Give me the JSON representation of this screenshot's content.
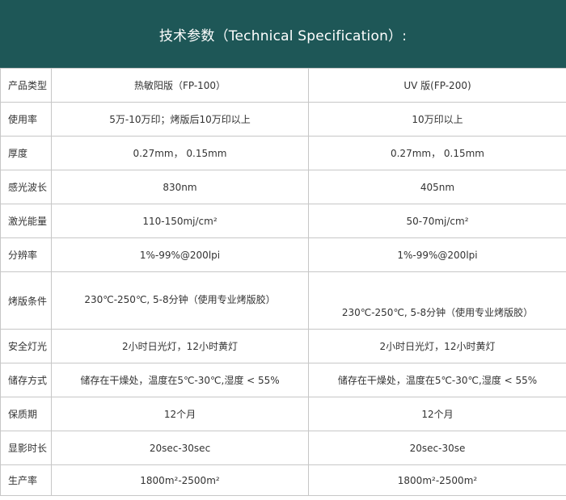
{
  "header": {
    "title": "技术参数（Technical Specification）:"
  },
  "table": {
    "rows": [
      {
        "label": "产品类型",
        "thermal": "热敏阳版（FP-100）",
        "uv": "UV 版(FP-200)"
      },
      {
        "label": "使用率",
        "thermal": "5万-10万印；烤版后10万印以上",
        "uv": "10万印以上"
      },
      {
        "label": "厚度",
        "thermal": "0.27mm， 0.15mm",
        "uv": "0.27mm， 0.15mm"
      },
      {
        "label": "感光波长",
        "thermal": "830nm",
        "uv": "405nm"
      },
      {
        "label": "激光能量",
        "thermal": "110-150mj/cm²",
        "uv": "50-70mj/cm²"
      },
      {
        "label": "分辨率",
        "thermal": "1%-99%@200lpi",
        "uv": "1%-99%@200lpi"
      },
      {
        "label": "烤版条件",
        "thermal": "230℃-250℃, 5-8分钟（使用专业烤版胶）",
        "uv": "230℃-250℃, 5-8分钟（使用专业烤版胶）"
      },
      {
        "label": "安全灯光",
        "thermal": "2小时日光灯，12小时黄灯",
        "uv": "2小时日光灯，12小时黄灯"
      },
      {
        "label": "储存方式",
        "thermal": "储存在干燥处，温度在5℃-30℃,湿度 < 55%",
        "uv": "储存在干燥处，温度在5℃-30℃,湿度 < 55%"
      },
      {
        "label": "保质期",
        "thermal": "12个月",
        "uv": "12个月"
      },
      {
        "label": "显影时长",
        "thermal": "20sec-30sec",
        "uv": "20sec-30se"
      },
      {
        "label": "生产率",
        "thermal": "1800m²-2500m²",
        "uv": "1800m²-2500m²"
      }
    ]
  },
  "colors": {
    "header_bg": "#1e5757",
    "header_text": "#ffffff",
    "border": "#c7c7c7",
    "text": "#333333"
  }
}
